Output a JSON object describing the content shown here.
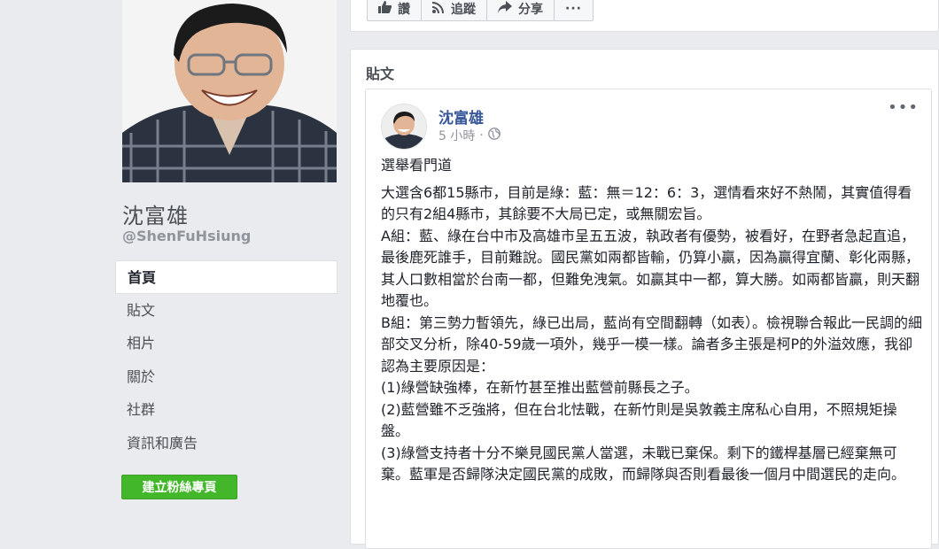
{
  "profile": {
    "name": "沈富雄",
    "handle": "@ShenFuHsiung"
  },
  "nav": {
    "items": [
      {
        "label": "首頁",
        "active": true
      },
      {
        "label": "貼文",
        "active": false
      },
      {
        "label": "相片",
        "active": false
      },
      {
        "label": "關於",
        "active": false
      },
      {
        "label": "社群",
        "active": false
      },
      {
        "label": "資訊和廣告",
        "active": false
      }
    ],
    "create_page_label": "建立粉絲專頁"
  },
  "action_bar": {
    "like_label": "讚",
    "follow_label": "追蹤",
    "share_label": "分享",
    "more_label": "···"
  },
  "posts": {
    "header": "貼文",
    "post": {
      "author": "沈富雄",
      "time": "5 小時",
      "separator": "·",
      "more": "•••",
      "lines": [
        "選舉看門道",
        "大選含6都15縣市，目前是綠：藍：無＝12：6：3，選情看來好不熱鬧，其實值得看的只有2組4縣市，其餘要不大局已定，或無關宏旨。",
        "A組：藍、綠在台中市及高雄市呈五五波，執政者有優勢，被看好，在野者急起直追，最後鹿死誰手，目前難說。國民黨如兩都皆輸，仍算小贏，因為贏得宜蘭、彰化兩縣，其人口數相當於台南一都，但難免洩氣。如贏其中一都，算大勝。如兩都皆贏，則天翻地覆也。",
        "B組：第三勢力暫領先，綠已出局，藍尚有空間翻轉（如表）。檢視聯合報此一民調的細部交叉分析，除40-59歲一項外，幾乎一模一樣。論者多主張是柯P的外溢效應，我卻認為主要原因是：",
        "(1)綠營缺強棒，在新竹甚至推出藍營前縣長之子。",
        "(2)藍營雖不乏強將，但在台北怯戰，在新竹則是吳敦義主席私心自用，不照規矩操盤。",
        "(3)綠營支持者十分不樂見國民黨人當選，未戰已棄保。剩下的鐵桿基層已經棄無可棄。藍軍是否歸隊決定國民黨的成敗，而歸隊與否則看最後一個月中間選民的走向。"
      ]
    }
  }
}
